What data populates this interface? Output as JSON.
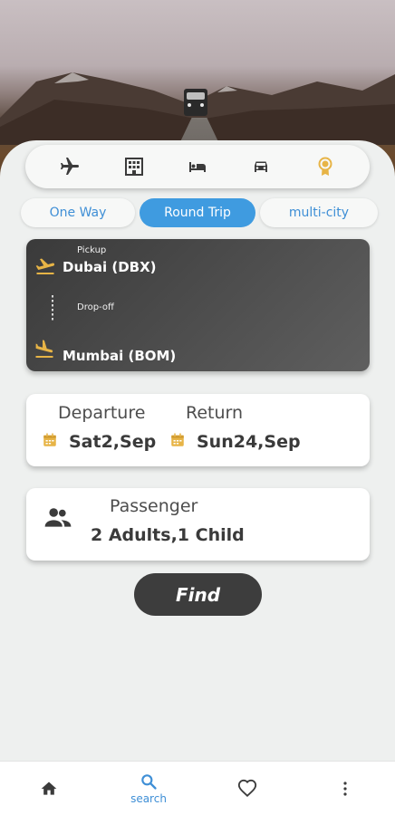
{
  "categories": [
    {
      "name": "flight",
      "icon": "airplane-icon"
    },
    {
      "name": "hotel",
      "icon": "building-icon"
    },
    {
      "name": "rooms",
      "icon": "bed-icon"
    },
    {
      "name": "car",
      "icon": "car-icon"
    },
    {
      "name": "offers",
      "icon": "badge-icon"
    }
  ],
  "trip_tabs": {
    "one_way": "One Way",
    "round_trip": "Round Trip",
    "multi_city": "multi-city",
    "active": "Round Trip"
  },
  "route": {
    "pickup_label": "Pickup",
    "pickup_city": "Dubai (DBX)",
    "dropoff_label": "Drop-off",
    "dropoff_city": "Mumbai (BOM)"
  },
  "dates": {
    "departure_label": "Departure",
    "departure_value": "Sat2,Sep",
    "return_label": "Return",
    "return_value": "Sun24,Sep"
  },
  "passenger": {
    "label": "Passenger",
    "value": "2 Adults,1 Child"
  },
  "find_label": "Find",
  "bottom_nav": {
    "search_label": "search"
  },
  "colors": {
    "accent": "#3f9be0",
    "icon_gold": "#e7b446",
    "dark": "#3d3d3d"
  }
}
